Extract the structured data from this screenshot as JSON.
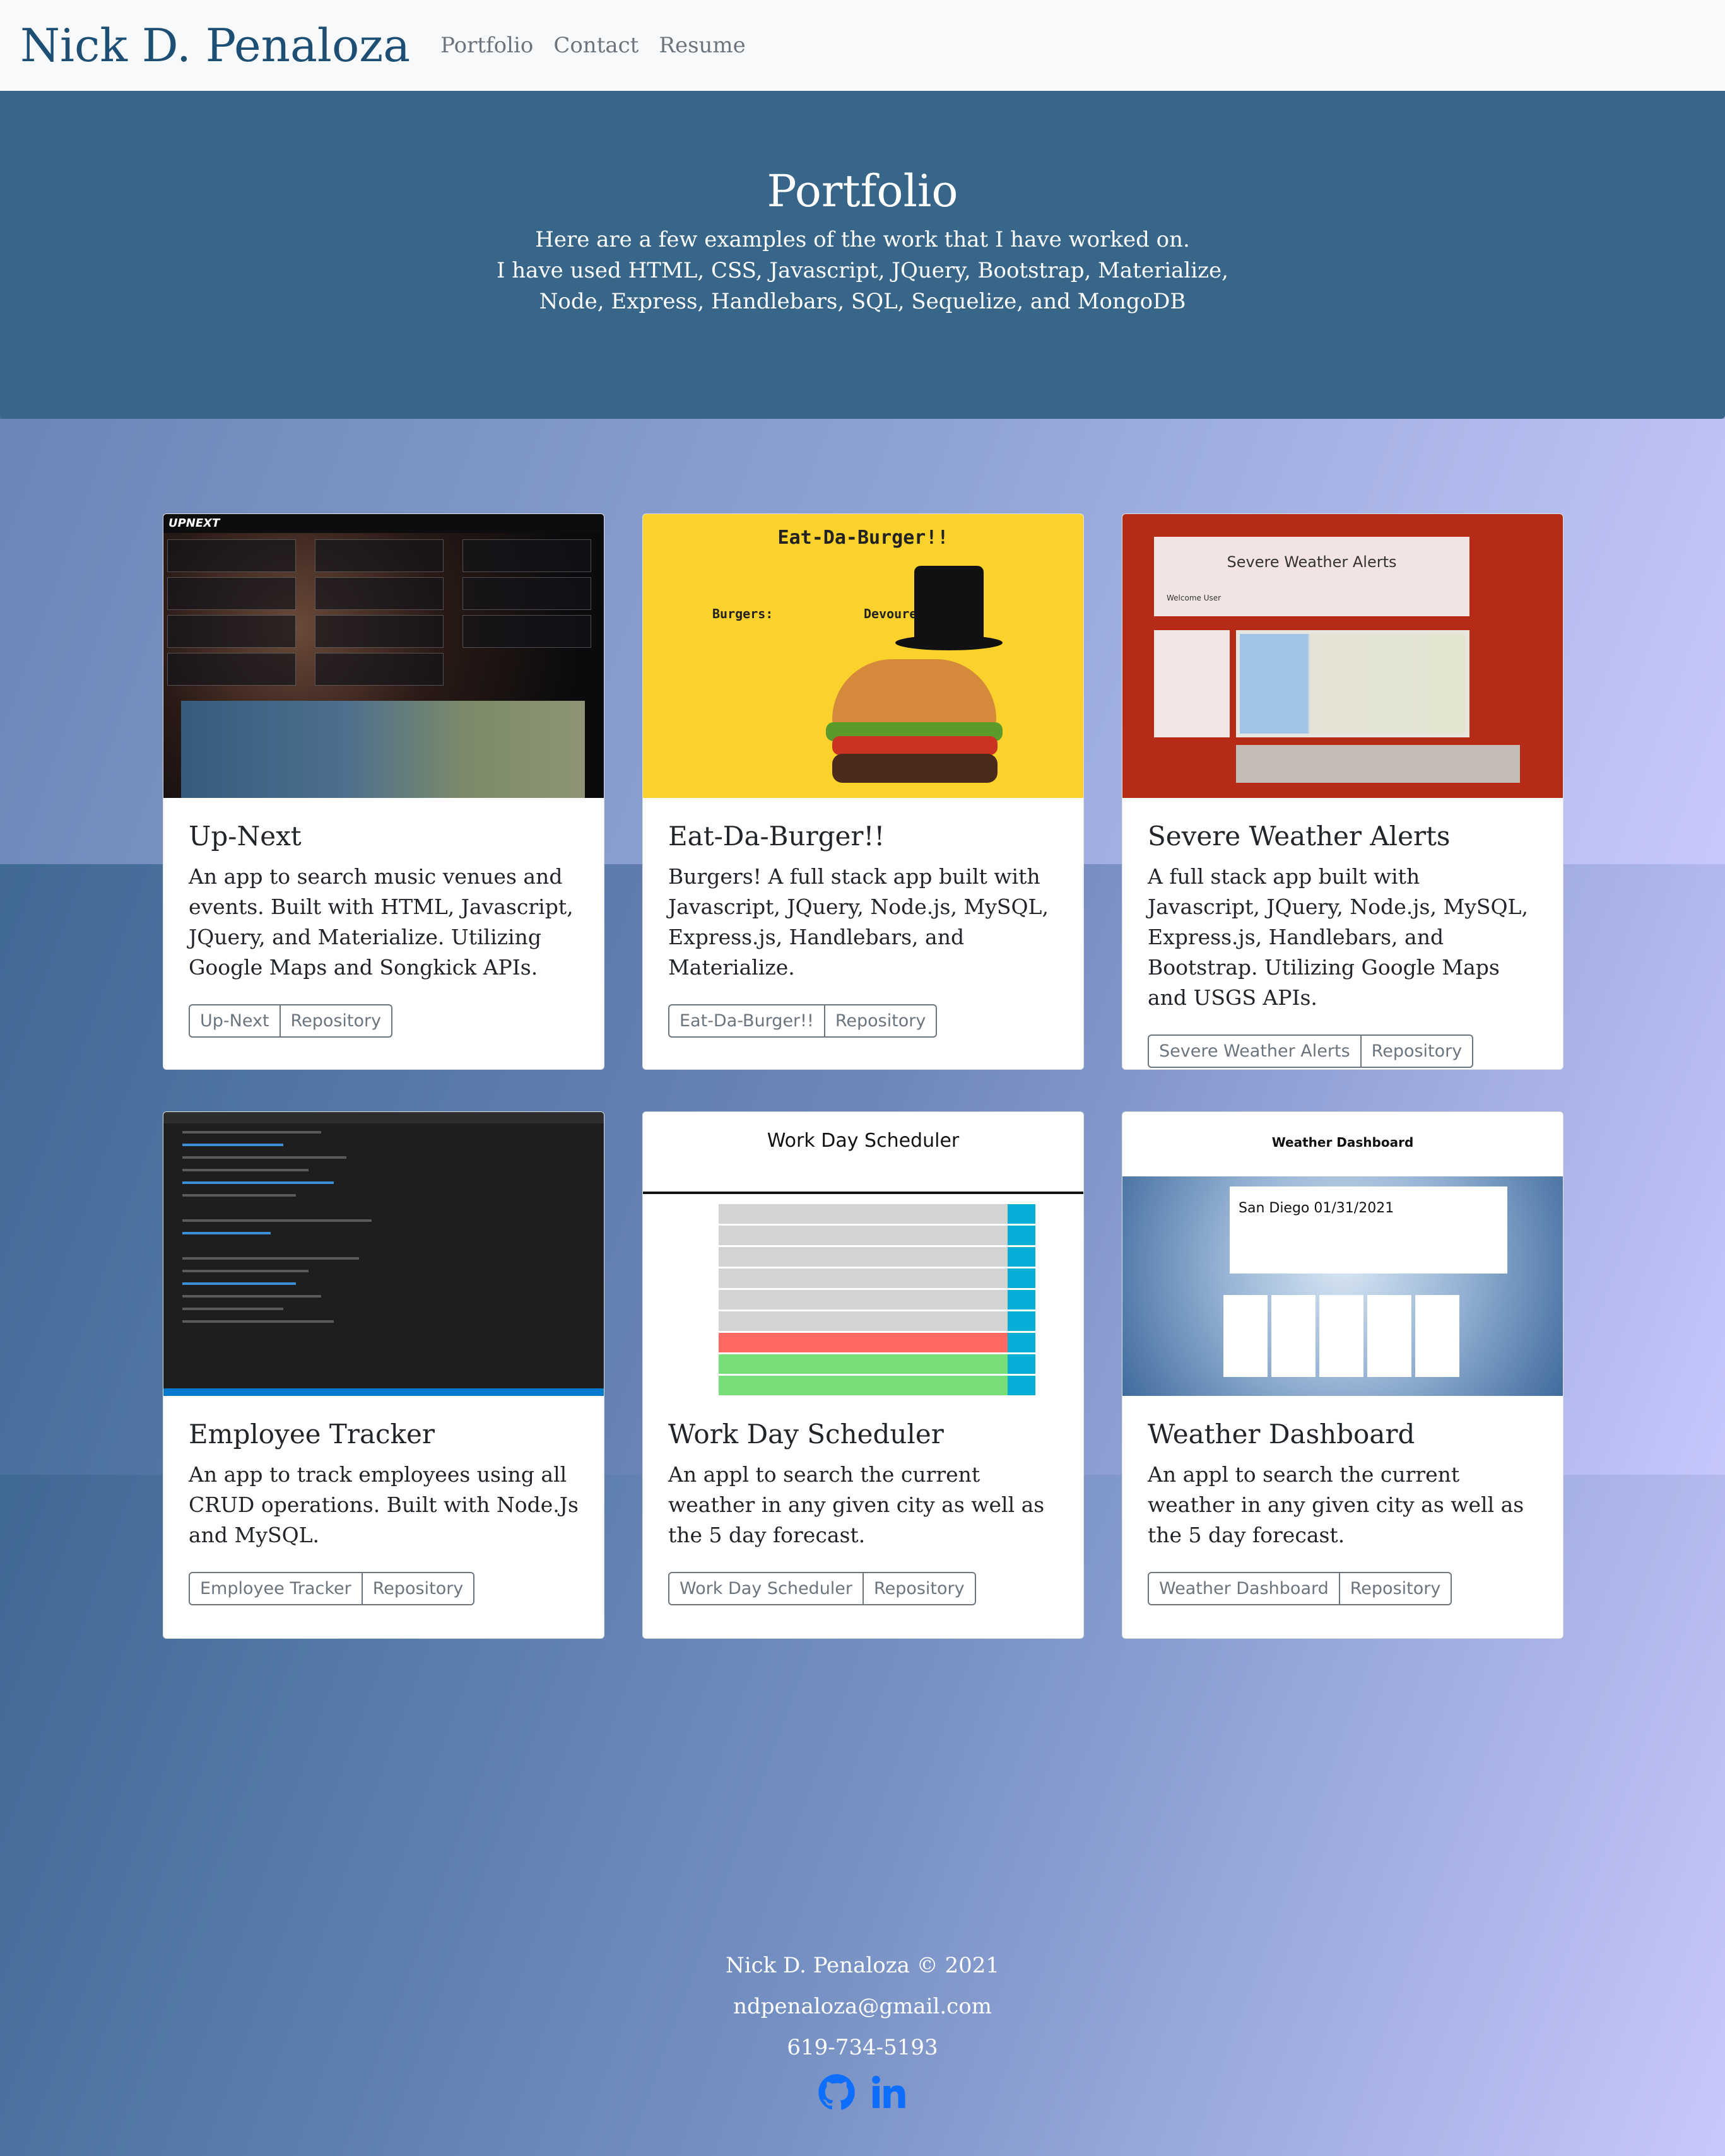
{
  "navbar": {
    "brand": "Nick D. Penaloza",
    "links": [
      "Portfolio",
      "Contact",
      "Resume"
    ]
  },
  "hero": {
    "title": "Portfolio",
    "lines": [
      "Here are a few examples of the work that I have worked on.",
      "I have used HTML, CSS, Javascript, JQuery, Bootstrap, Materialize,",
      "Node, Express, Handlebars, SQL, Sequelize, and MongoDB"
    ]
  },
  "projects": [
    {
      "title": "Up-Next",
      "description": "An app to search music venues and events. Built with HTML, Javascript, JQuery, and Materialize. Utilizing Google Maps and Songkick APIs.",
      "app_label": "Up-Next",
      "repo_label": "Repository",
      "thumb": {
        "logo": "UPNEXT"
      }
    },
    {
      "title": "Eat-Da-Burger!!",
      "description": "Burgers! A full stack app built with Javascript, JQuery, Node.js, MySQL, Express.js, Handlebars, and Materialize.",
      "app_label": "Eat-Da-Burger!!",
      "repo_label": "Repository",
      "thumb": {
        "heading": "Eat-Da-Burger!!",
        "left_label": "Burgers:",
        "right_label": "Devoured:"
      }
    },
    {
      "title": "Severe Weather Alerts",
      "description": "A full stack app built with Javascript, JQuery, Node.js, MySQL, Express.js, Handlebars, and Bootstrap. Utilizing Google Maps and USGS APIs.",
      "app_label": "Severe Weather Alerts",
      "repo_label": "Repository",
      "thumb": {
        "heading": "Severe Weather Alerts",
        "welcome": "Welcome User"
      }
    },
    {
      "title": "Employee Tracker",
      "description": "An app to track employees using all CRUD operations. Built with Node.Js and MySQL.",
      "app_label": "Employee Tracker",
      "repo_label": "Repository",
      "thumb": {}
    },
    {
      "title": "Work Day Scheduler",
      "description": "An appl to search the current weather in any given city as well as the 5 day forecast.",
      "app_label": "Work Day Scheduler",
      "repo_label": "Repository",
      "thumb": {
        "heading": "Work Day Scheduler"
      }
    },
    {
      "title": "Weather Dashboard",
      "description": "An appl to search the current weather in any given city as well as the 5 day forecast.",
      "app_label": "Weather Dashboard",
      "repo_label": "Repository",
      "thumb": {
        "heading": "Weather Dashboard",
        "city": "San Diego 01/31/2021"
      }
    }
  ],
  "footer": {
    "copyright": "Nick D. Penaloza © 2021",
    "email": "ndpenaloza@gmail.com",
    "phone": "619-734-5193",
    "social_icons": [
      "github-icon",
      "linkedin-icon"
    ]
  },
  "colors": {
    "navbar_bg": "#f8f9fa",
    "brand": "#1d4f75",
    "hero_bg": "#376688",
    "social_icon": "#0d6efd"
  }
}
